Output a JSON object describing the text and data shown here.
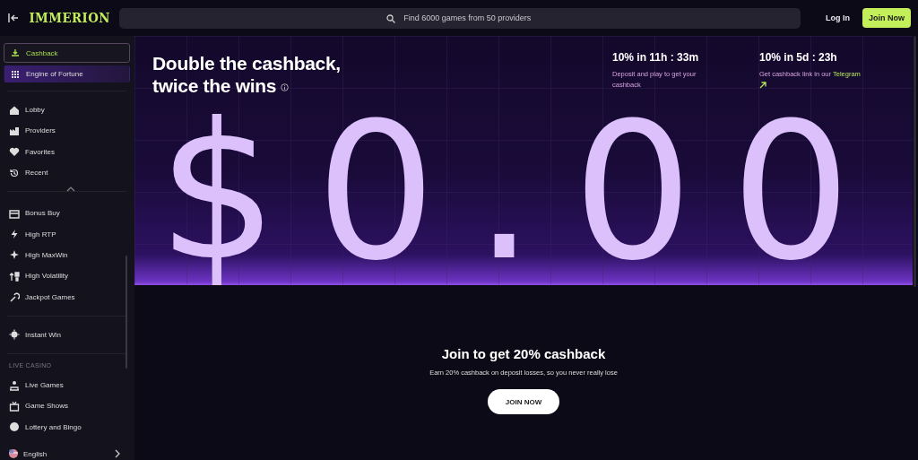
{
  "topbar": {
    "logo": "IMMERION",
    "search": {
      "placeholder": "Find 6000 games from 50 providers"
    },
    "buttons": [
      {
        "label": "Log In",
        "kind": "text"
      },
      {
        "label": "Join Now",
        "kind": "primary"
      }
    ]
  },
  "sidebar": {
    "promos": [
      {
        "label": "Cashback",
        "selected": true
      },
      {
        "label": "Engine of Fortune",
        "selected": false
      }
    ],
    "groups": [
      {
        "items": [
          {
            "label": "Lobby",
            "selected": false
          },
          {
            "label": "Providers",
            "selected": false
          },
          {
            "label": "Favorites",
            "selected": false
          },
          {
            "label": "Recent",
            "selected": false
          }
        ]
      },
      {
        "items": [
          {
            "label": "Bonus Buy",
            "selected": false
          },
          {
            "label": "High RTP",
            "selected": false
          },
          {
            "label": "High MaxWin",
            "selected": false
          },
          {
            "label": "High Volatility",
            "selected": false
          },
          {
            "label": "Jackpot Games",
            "selected": false
          }
        ]
      },
      {
        "items": [
          {
            "label": "Instant Win",
            "selected": false
          }
        ]
      },
      {
        "title": "LIVE CASINO",
        "items": [
          {
            "label": "Live Games",
            "selected": false
          },
          {
            "label": "Game Shows",
            "selected": false
          },
          {
            "label": "Lottery and Bingo",
            "selected": false
          }
        ]
      }
    ],
    "language": "English"
  },
  "hero": {
    "title": "Double the cashback, twice the wins",
    "timers": [
      {
        "heading": "10% in 11h : 33m",
        "text": "Deposit and play to get your cashback"
      },
      {
        "heading": "10% in 5d : 23h",
        "text": "Get cashback link in our",
        "link": "Telegram"
      }
    ],
    "amount": "$0.00"
  },
  "join": {
    "heading": "Join to get 20% cashback",
    "text": "Earn 20% cashback on deposit losses, so you never really lose",
    "button": "JOIN NOW"
  }
}
